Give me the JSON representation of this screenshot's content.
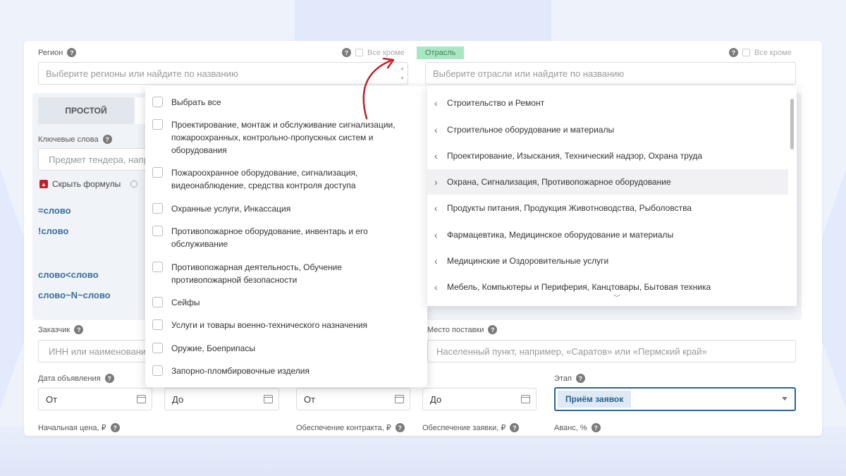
{
  "region": {
    "label": "Регион",
    "except_label": "Все кроме",
    "placeholder": "Выберите регионы или найдите по названию"
  },
  "industry": {
    "tag": "Отрасль",
    "except_label": "Все кроме",
    "placeholder": "Выберите отрасли или найдите по названию"
  },
  "search_mode": {
    "simple": "ПРОСТОЙ"
  },
  "keywords": {
    "label": "Ключевые слова",
    "placeholder": "Предмет тендера, например",
    "hide_formulas": "Скрыть формулы",
    "formulas": [
      "=слово",
      "!слово",
      "слово<слово",
      "слово~N~слово"
    ]
  },
  "customer": {
    "label": "Заказчик",
    "placeholder": "ИНН или наименование"
  },
  "delivery": {
    "label": "Место поставки",
    "placeholder": "Населенный пункт, например, «Саратов» или «Пермский край»"
  },
  "announce_date": {
    "label": "Дата объявления",
    "from": "От",
    "to": "До"
  },
  "second_date": {
    "from": "От",
    "to": "До"
  },
  "stage": {
    "label": "Этап",
    "value": "Приём заявок"
  },
  "bottom_labels": {
    "price": "Начальная цена, ₽",
    "contract_security": "Обеспечение контракта, ₽",
    "bid_security": "Обеспечение заявки, ₽",
    "advance": "Аванс, %"
  },
  "left_dropdown": {
    "select_all": "Выбрать все",
    "items": [
      [
        "Проектирование, монтаж и обслуживание сигнализации,",
        "пожароохранных, контрольно-пропускных систем и",
        "оборудования"
      ],
      [
        "Пожароохранное оборудование, сигнализация,",
        "видеонаблюдение, средства контроля доступа"
      ],
      [
        "Охранные услуги, Инкассация"
      ],
      [
        "Противопожарное оборудование, инвентарь и его",
        "обслуживание"
      ],
      [
        "Противопожарная деятельность, Обучение",
        "противопожарной безопасности"
      ],
      [
        "Сейфы"
      ],
      [
        "Услуги и товары военно-технического назначения"
      ],
      [
        "Оружие, Боеприпасы"
      ],
      [
        "Запорно-пломбировочные изделия"
      ]
    ]
  },
  "right_dropdown": {
    "items": [
      "Строительство и Ремонт",
      "Строительное оборудование и материалы",
      "Проектирование, Изыскания, Технический надзор, Охрана труда",
      "Охрана, Сигнализация, Противопожарное оборудование",
      "Продукты питания, Продукция Животноводства, Рыболовства",
      "Фармацевтика, Медицинское оборудование и материалы",
      "Медицинские и Оздоровительные услуги",
      "Мебель, Компьютеры и Периферия, Канцтовары, Бытовая техника"
    ],
    "highlighted_index": 3
  },
  "colors": {
    "accent": "#2a6496",
    "tag_green": "#a7e8c2",
    "arrow": "#c0202a"
  }
}
